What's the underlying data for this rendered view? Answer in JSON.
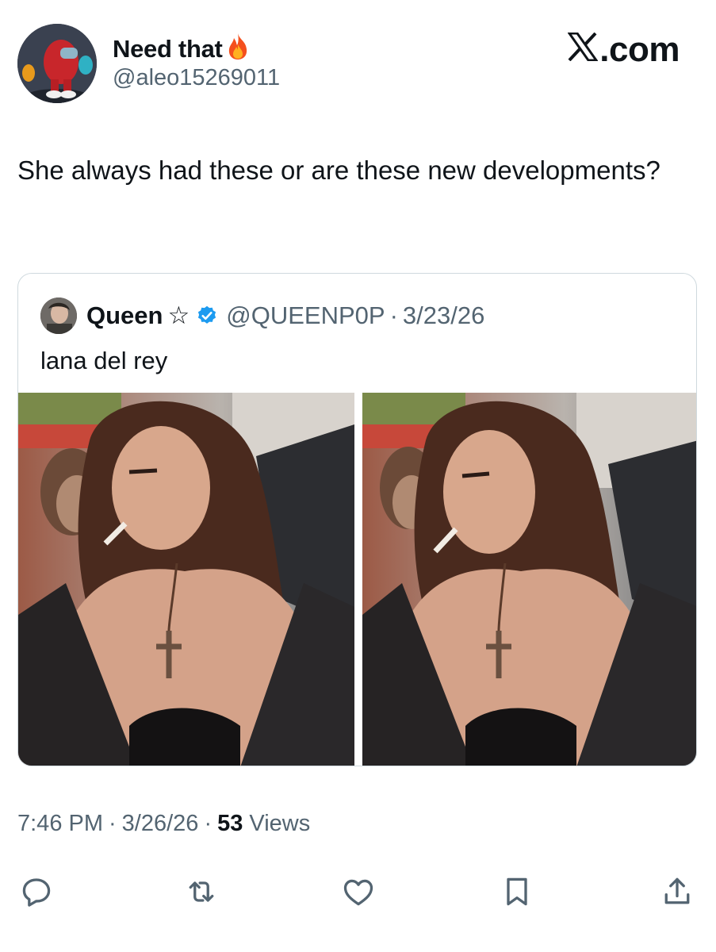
{
  "author": {
    "display_name": "Need that",
    "name_emoji": "fire-emoji",
    "handle": "@aleo15269011",
    "avatar_icon": "avatar-3d-characters"
  },
  "brand": {
    "label": ".com",
    "logo_icon": "x-logo-icon"
  },
  "tweet": {
    "text": "She always had these or are these new developments?",
    "time": "7:46 PM",
    "date": "3/26/26",
    "views_count": "53",
    "views_label": "Views",
    "separator": "·"
  },
  "quote": {
    "display_name": "Queen",
    "star": "☆",
    "verified_icon": "verified-badge-icon",
    "handle": "@QUEENP0P",
    "separator": "·",
    "date": "3/23/26",
    "text": "lana del rey",
    "media": [
      "photo-1",
      "photo-2"
    ]
  },
  "actions": [
    "reply-icon",
    "repost-icon",
    "like-icon",
    "bookmark-icon",
    "share-icon"
  ],
  "colors": {
    "text": "#0f1419",
    "secondary": "#536471",
    "border": "#cfd9de",
    "verified": "#1d9bf0",
    "fire": "#f4501e"
  }
}
